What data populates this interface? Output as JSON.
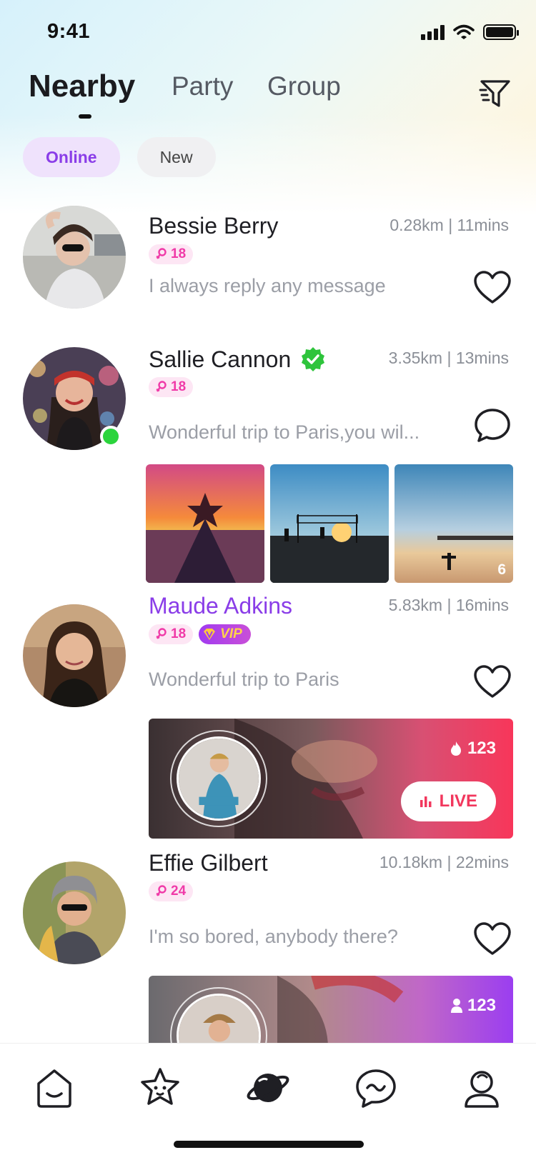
{
  "status_bar": {
    "time": "9:41"
  },
  "header": {
    "tabs": [
      {
        "label": "Nearby",
        "active": true
      },
      {
        "label": "Party",
        "active": false
      },
      {
        "label": "Group",
        "active": false
      }
    ],
    "filter_icon": "filter-icon"
  },
  "chips": [
    {
      "label": "Online",
      "active": true
    },
    {
      "label": "New",
      "active": false
    }
  ],
  "feed": [
    {
      "name": "Bessie Berry",
      "distance": "0.28km | 11mins",
      "age": "18",
      "message": "I always reply any message",
      "action_icon": "heart-icon"
    },
    {
      "name": "Sallie Cannon",
      "verified": true,
      "online": true,
      "distance": "3.35km | 13mins",
      "age": "18",
      "message": "Wonderful trip to Paris,you wil...",
      "action_icon": "chat-bubble-icon",
      "photo_count": "6"
    },
    {
      "name": "Maude Adkins",
      "vip": true,
      "vip_label": "VIP",
      "distance": "5.83km | 16mins",
      "age": "18",
      "message": "Wonderful trip to Paris",
      "action_icon": "heart-icon",
      "live": {
        "viewers": "123",
        "button_label": "LIVE"
      }
    },
    {
      "name": "Effie Gilbert",
      "distance": "10.18km | 22mins",
      "age": "24",
      "message": "I'm so bored,  anybody there?",
      "action_icon": "heart-icon",
      "party": {
        "viewers": "123"
      }
    }
  ],
  "tab_bar": [
    {
      "icon": "home-icon",
      "active": false
    },
    {
      "icon": "star-face-icon",
      "active": false
    },
    {
      "icon": "planet-icon",
      "active": true
    },
    {
      "icon": "message-icon",
      "active": false
    },
    {
      "icon": "profile-icon",
      "active": false
    }
  ],
  "colors": {
    "accent_purple": "#8a3de8",
    "age_pink": "#f03aa8",
    "online_green": "#2bd43c",
    "live_red": "#f2375d",
    "verified_green": "#2ec43c"
  }
}
